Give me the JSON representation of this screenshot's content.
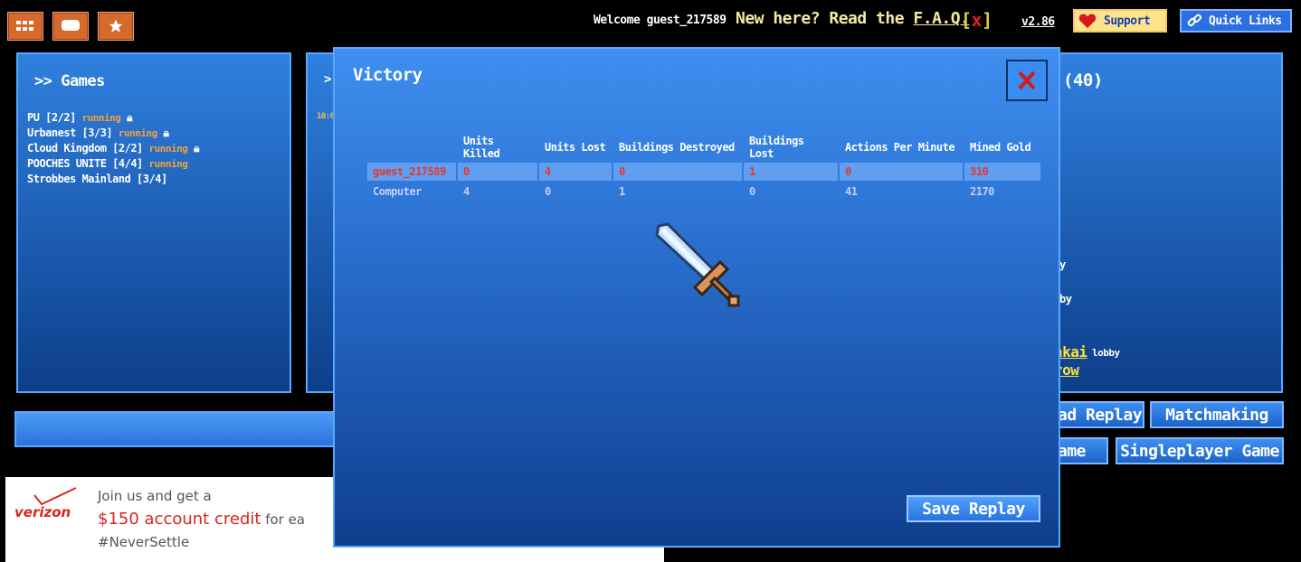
{
  "header": {
    "welcome": "Welcome guest_217589",
    "faq_prefix": "New here? Read the ",
    "faq_link": "F.A.Q.",
    "faq_close_left": "[",
    "faq_close_x": "x",
    "faq_close_right": "]",
    "version": "v2.86",
    "support_label": "Support",
    "quick_links_label": "Quick Links",
    "icons": [
      "menu-icon",
      "chat-icon",
      "star-icon",
      "heart-icon",
      "link-icon"
    ]
  },
  "games_panel": {
    "title": ">> Games",
    "items": [
      {
        "name": "PU [2/2]",
        "status": "running",
        "locked": true
      },
      {
        "name": "Urbanest [3/3]",
        "status": "running",
        "locked": true
      },
      {
        "name": "Cloud Kingdom [2/2]",
        "status": "running",
        "locked": true
      },
      {
        "name": "POOCHES UNITE [4/4]",
        "status": "running",
        "locked": false
      },
      {
        "name": "Strobbes Mainland [3/4]",
        "status": "",
        "locked": false
      }
    ]
  },
  "chat_panel": {
    "title_fragment": ">",
    "time_fragment": "10:0"
  },
  "players_panel": {
    "title_fragment": "(40)",
    "fragments": [
      "y",
      "by",
      "nkai",
      "lobby",
      "row"
    ]
  },
  "lobby_buttons": {
    "load_replay": "ad Replay",
    "matchmaking": "Matchmaking",
    "game_fragment": "ame",
    "singleplayer": "Singleplayer Game"
  },
  "modal": {
    "title": "Victory",
    "close_label": "X",
    "columns": [
      "Units Killed",
      "Units Lost",
      "Buildings Destroyed",
      "Buildings Lost",
      "Actions Per Minute",
      "Mined Gold"
    ],
    "rows": [
      {
        "player": "guest_217589",
        "values": [
          "0",
          "4",
          "0",
          "1",
          "0",
          "310"
        ]
      },
      {
        "player": "Computer",
        "values": [
          "4",
          "0",
          "1",
          "0",
          "41",
          "2170"
        ]
      }
    ],
    "save_replay": "Save Replay",
    "icon": "sword-icon"
  },
  "ad": {
    "brand": "verizon",
    "line1": "Join us and get a",
    "line2_highlight": "$150 account credit",
    "line2_rest": " for ea",
    "line3": "#NeverSettle"
  },
  "colors": {
    "accent_orange": "#d6692c",
    "panel_blue": "#2f80df",
    "player_red": "#e7372a",
    "running_orange": "#f2a33a"
  }
}
